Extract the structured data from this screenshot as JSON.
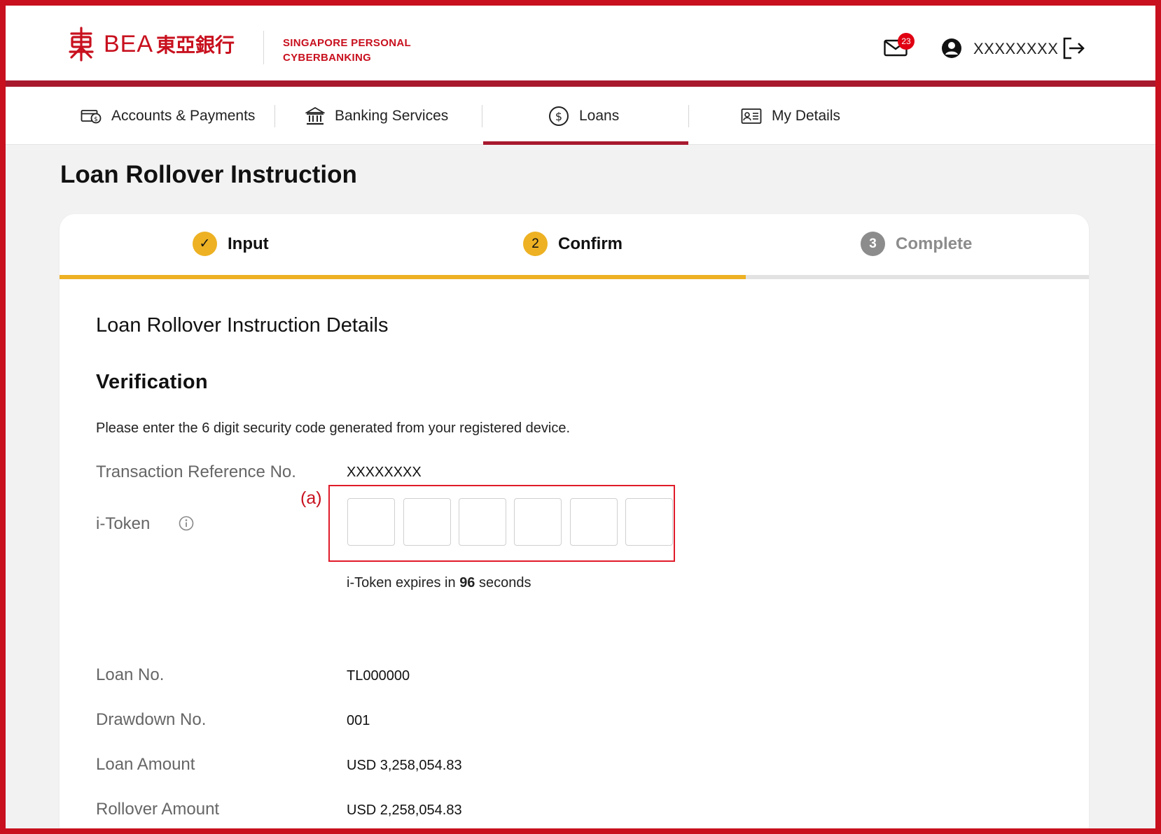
{
  "header": {
    "brand": "BEA",
    "brand_cn": "東亞銀行",
    "subtitle_line1": "SINGAPORE PERSONAL",
    "subtitle_line2": "CYBERBANKING",
    "mail_badge": "23",
    "username": "XXXXXXXX"
  },
  "nav": {
    "items": [
      {
        "label": "Accounts & Payments",
        "icon": "wallet-icon"
      },
      {
        "label": "Banking Services",
        "icon": "bank-icon"
      },
      {
        "label": "Loans",
        "icon": "dollar-circle-icon",
        "active": true
      },
      {
        "label": "My Details",
        "icon": "id-card-icon"
      }
    ]
  },
  "page": {
    "title": "Loan Rollover Instruction"
  },
  "steps": [
    {
      "label": "Input",
      "marker": "✓",
      "state": "done"
    },
    {
      "label": "Confirm",
      "marker": "2",
      "state": "current"
    },
    {
      "label": "Complete",
      "marker": "3",
      "state": "pending"
    }
  ],
  "content": {
    "section_title": "Loan Rollover Instruction Details",
    "verification_title": "Verification",
    "instruction": "Please enter the 6 digit security code generated from your registered device.",
    "txn_ref_label": "Transaction Reference No.",
    "txn_ref_value": "XXXXXXXX",
    "itoken_label": "i-Token",
    "annotation": "(a)",
    "otp_values": [
      "",
      "",
      "",
      "",
      "",
      ""
    ],
    "expiry_prefix": "i-Token expires in",
    "expiry_seconds": "96",
    "expiry_suffix": "seconds",
    "details": [
      {
        "label": "Loan No.",
        "value": "TL000000"
      },
      {
        "label": "Drawdown No.",
        "value": "001"
      },
      {
        "label": "Loan Amount",
        "value": "USD 3,258,054.83"
      },
      {
        "label": "Rollover Amount",
        "value": "USD 2,258,054.83"
      }
    ]
  },
  "colors": {
    "brand_red": "#c8101e",
    "nav_bar": "#a8192e",
    "step_yellow": "#edb123",
    "step_grey": "#8c8c8c"
  }
}
